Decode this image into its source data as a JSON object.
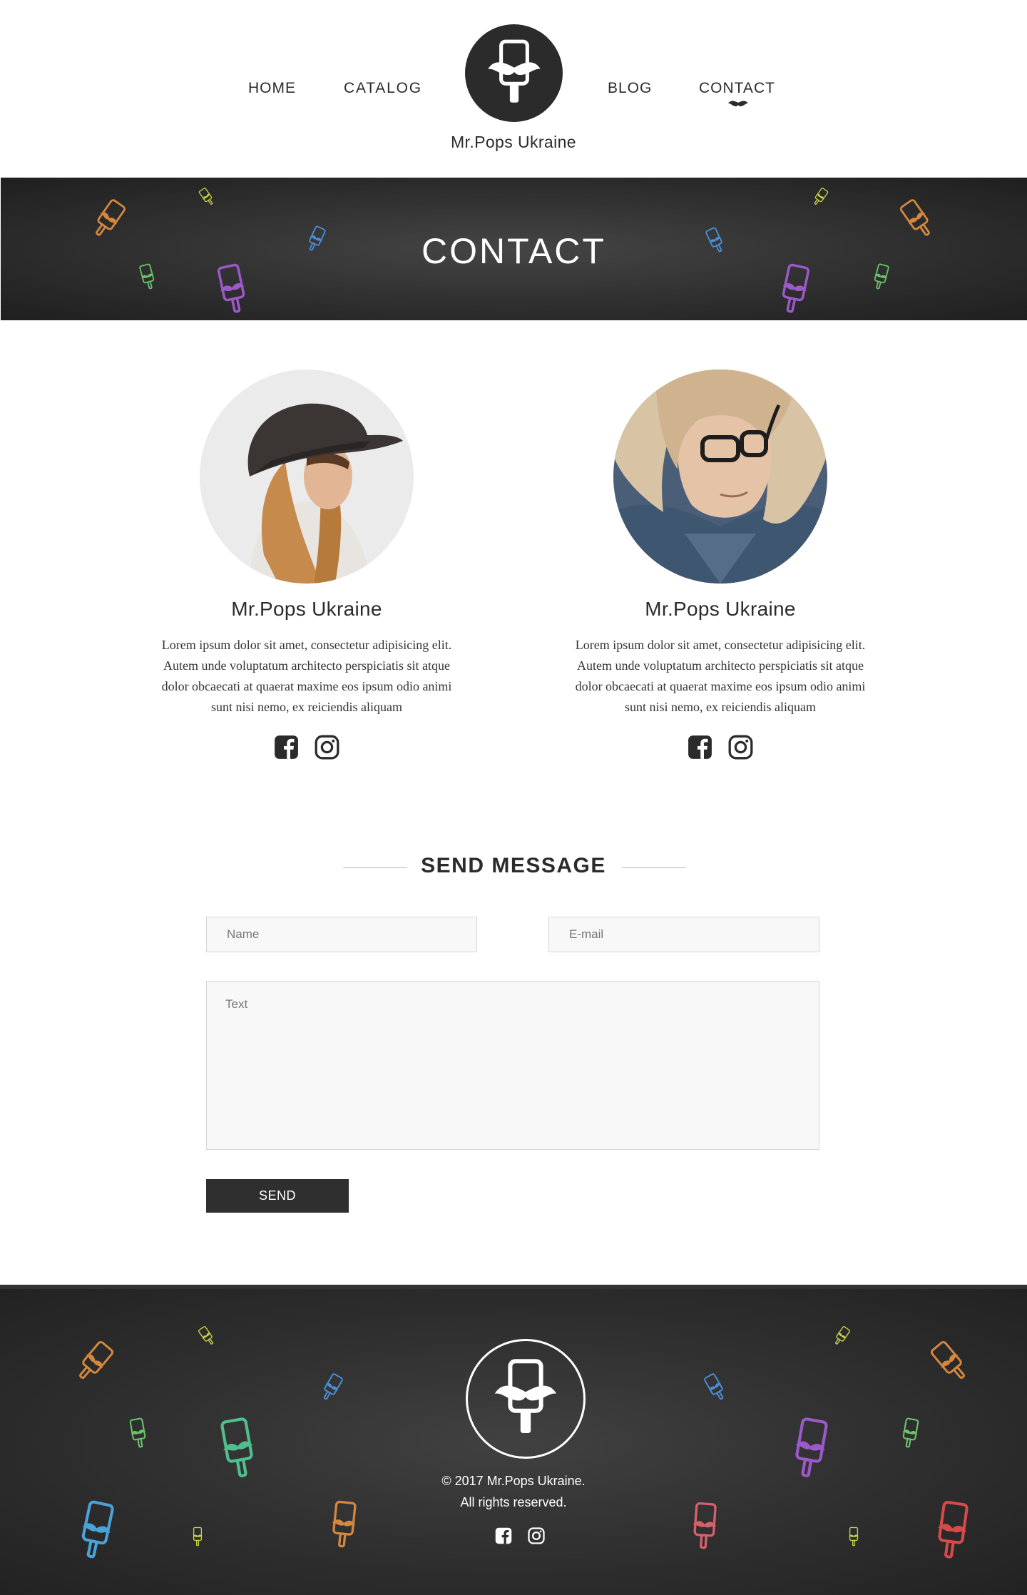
{
  "nav": {
    "items": [
      {
        "label": "HOME"
      },
      {
        "label": "CATALOG"
      },
      {
        "label": "BLOG"
      },
      {
        "label": "CONTACT",
        "active": true
      }
    ],
    "brand": "Mr.Pops Ukraine"
  },
  "hero": {
    "title": "CONTACT"
  },
  "team": [
    {
      "name": "Mr.Pops Ukraine",
      "bio": "Lorem ipsum dolor sit amet, consectetur adipisicing elit. Autem unde voluptatum architecto perspiciatis sit atque dolor obcaecati at quaerat maxime eos ipsum odio animi sunt nisi nemo, ex reiciendis aliquam",
      "socials": [
        "facebook-icon",
        "instagram-icon"
      ]
    },
    {
      "name": "Mr.Pops Ukraine",
      "bio": "Lorem ipsum dolor sit amet, consectetur adipisicing elit. Autem unde voluptatum architecto perspiciatis sit atque dolor obcaecati at quaerat maxime eos ipsum odio animi sunt nisi nemo, ex reiciendis aliquam",
      "socials": [
        "facebook-icon",
        "instagram-icon"
      ]
    }
  ],
  "contact_form": {
    "title": "SEND MESSAGE",
    "name_placeholder": "Name",
    "email_placeholder": "E-mail",
    "text_placeholder": "Text",
    "name_value": "",
    "email_value": "",
    "text_value": "",
    "send_label": "SEND"
  },
  "footer": {
    "copyright_line1": "© 2017 Mr.Pops Ukraine.",
    "copyright_line2": "All rights reserved.",
    "socials": [
      "facebook-icon",
      "instagram-icon"
    ]
  },
  "colors": {
    "dark": "#2b2b2b",
    "banner": "#333333",
    "pop_orange": "#d4873f",
    "pop_yellow": "#c9d14a",
    "pop_blue": "#4a90d9",
    "pop_green": "#6ac46a",
    "pop_purple": "#9b59c9",
    "pop_teal": "#4fc08d",
    "pop_red": "#d84a4a",
    "pop_pink": "#d8606a"
  }
}
